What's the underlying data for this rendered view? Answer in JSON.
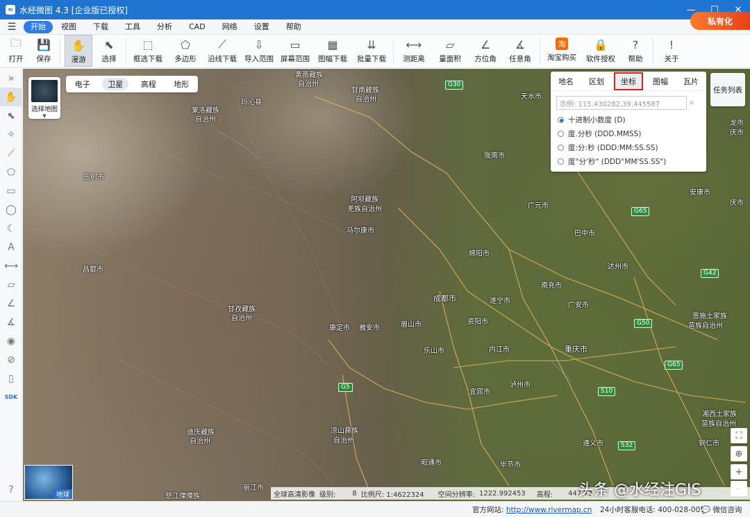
{
  "titlebar": {
    "title": "水经微图 4.3 [企业版已授权]"
  },
  "menu": [
    "开始",
    "视图",
    "下载",
    "工具",
    "分析",
    "CAD",
    "网络",
    "设置",
    "帮助"
  ],
  "toolbar": [
    {
      "label": "打开",
      "icon": "folder-icon",
      "glyph": "🗀"
    },
    {
      "label": "保存",
      "icon": "save-icon",
      "glyph": "💾"
    },
    {
      "label": "漫游",
      "icon": "hand-icon",
      "glyph": "✋",
      "selected": true
    },
    {
      "label": "选择",
      "icon": "pointer-icon",
      "glyph": "⬉"
    },
    {
      "label": "框选下载",
      "icon": "box-download-icon",
      "glyph": "⬚"
    },
    {
      "label": "多边形",
      "icon": "polygon-download-icon",
      "glyph": "⬠"
    },
    {
      "label": "沿线下载",
      "icon": "line-download-icon",
      "glyph": "⟋"
    },
    {
      "label": "导入范围",
      "icon": "import-range-icon",
      "glyph": "⇩"
    },
    {
      "label": "屏幕范围",
      "icon": "screen-range-icon",
      "glyph": "▭"
    },
    {
      "label": "图幅下载",
      "icon": "sheet-download-icon",
      "glyph": "▦"
    },
    {
      "label": "批量下载",
      "icon": "batch-download-icon",
      "glyph": "⇊"
    },
    {
      "label": "测距离",
      "icon": "measure-distance-icon",
      "glyph": "⟷"
    },
    {
      "label": "量面积",
      "icon": "measure-area-icon",
      "glyph": "▱"
    },
    {
      "label": "方位角",
      "icon": "azimuth-icon",
      "glyph": "∠"
    },
    {
      "label": "任意角",
      "icon": "any-angle-icon",
      "glyph": "∡"
    },
    {
      "label": "淘宝购买",
      "icon": "taobao-icon",
      "glyph": "淘"
    },
    {
      "label": "软件授权",
      "icon": "lock-icon",
      "glyph": "🔒"
    },
    {
      "label": "帮助",
      "icon": "help-icon",
      "glyph": "?"
    },
    {
      "label": "关于",
      "icon": "info-icon",
      "glyph": "!"
    }
  ],
  "private_button": "私有化",
  "basemap": {
    "tabs": [
      "电子",
      "卫星",
      "高程",
      "地形"
    ],
    "active": "卫星"
  },
  "select_map_label": "选择地图",
  "search_panel": {
    "tabs": [
      "地名",
      "区划",
      "坐标",
      "图幅",
      "瓦片"
    ],
    "active": "坐标",
    "placeholder": "示例: 115.430282,39.445587",
    "options": [
      "十进制小数度 (D)",
      "度.分秒 (DDD.MMSS)",
      "度:分:秒 (DDD:MM:SS.SS)",
      "度°分'秒\" (DDD°MM'SS.SS\")"
    ],
    "selected_index": 0
  },
  "task_list_label": "任务列表",
  "globe_label": "地球",
  "cities": [
    {
      "name": "黄南藏族",
      "sub": "自治州"
    },
    {
      "name": "甘南藏族",
      "sub": "自治州"
    },
    {
      "name": "玛沁县"
    },
    {
      "name": "果洛藏族",
      "sub": "自治州"
    },
    {
      "name": "天水市"
    },
    {
      "name": "陇南市"
    },
    {
      "name": "玉树市"
    },
    {
      "name": "阿坝藏族",
      "sub": "羌族自治州"
    },
    {
      "name": "马尔康市"
    },
    {
      "name": "广元市"
    },
    {
      "name": "巴中市"
    },
    {
      "name": "安康市"
    },
    {
      "name": "昌都市"
    },
    {
      "name": "绵阳市"
    },
    {
      "name": "达州市"
    },
    {
      "name": "南充市"
    },
    {
      "name": "成都市"
    },
    {
      "name": "遂宁市"
    },
    {
      "name": "广安市"
    },
    {
      "name": "甘孜藏族",
      "sub": "自治州"
    },
    {
      "name": "康定市"
    },
    {
      "name": "雅安市"
    },
    {
      "name": "眉山市"
    },
    {
      "name": "资阳市"
    },
    {
      "name": "恩施土家族",
      "sub": "苗族自治州"
    },
    {
      "name": "乐山市"
    },
    {
      "name": "内江市"
    },
    {
      "name": "重庆市"
    },
    {
      "name": "宜宾市"
    },
    {
      "name": "泸州市"
    },
    {
      "name": "凉山彝族",
      "sub": "自治州"
    },
    {
      "name": "迪庆藏族",
      "sub": "自治州"
    },
    {
      "name": "湘西土家族",
      "sub": "苗族自治州"
    },
    {
      "name": "遵义市"
    },
    {
      "name": "铜仁市"
    },
    {
      "name": "昭通市"
    },
    {
      "name": "毕节市"
    },
    {
      "name": "丽江市"
    },
    {
      "name": "怒江傈僳族"
    },
    {
      "name": "庆市"
    },
    {
      "name": "庆市"
    },
    {
      "name": "龙市"
    }
  ],
  "highways": [
    "G30",
    "G65",
    "G42",
    "G50",
    "G65",
    "G5",
    "S10",
    "S32"
  ],
  "infobar": {
    "source": "全球高清影像",
    "level_label": "级别:",
    "level": "8",
    "scale_label": "比例尺: 1:4622324",
    "res_label": "空间分辨率:",
    "res": "1222.992453",
    "elev_label": "高程:",
    "elev": "447.73"
  },
  "watermark": "头条 @水经注GIS",
  "status": {
    "site_label": "官方网站:",
    "site_url": "http://www.rivermap.cn",
    "tel": "24小时客服电话: 400-028-0050",
    "help": "微信咨询"
  }
}
